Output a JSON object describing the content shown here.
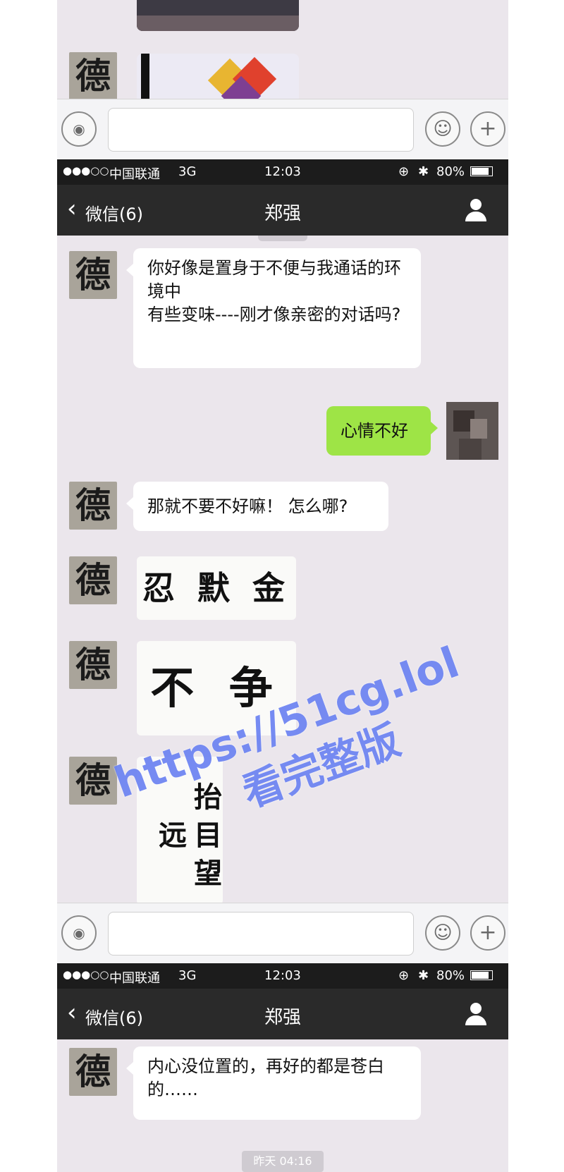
{
  "status_bar": {
    "signal": "●●●○○",
    "carrier": "中国联通",
    "network": "3G",
    "time": "12:03",
    "battery": "80%"
  },
  "nav_bar": {
    "back_label": "微信(6)",
    "title": "郑强"
  },
  "avatar_char": "德",
  "messages_screen2": [
    "你好像是置身于不便与我通话的环境中\n有些变味----刚才像亲密的对话吗?",
    "心情不好",
    "那就不要不好嘛！ 怎么哪?"
  ],
  "calligraphy": [
    "忍 默 金",
    "不 争",
    "抬 目 望 远"
  ],
  "messages_screen3": [
    "内心没位置的，再好的都是苍白的……"
  ],
  "timestamp": "昨天 04:16",
  "watermark": {
    "line1": "https://51cg.lol",
    "line2": "看完整版"
  },
  "colors": {
    "accent_green": "#9ee446",
    "nav_dark": "#2a2a2a",
    "watermark_blue": "#6f86f2"
  }
}
